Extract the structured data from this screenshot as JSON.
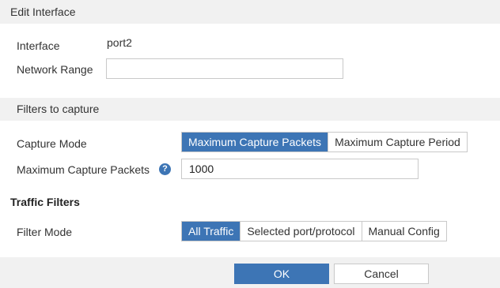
{
  "dialog": {
    "title": "Edit Interface"
  },
  "interface": {
    "label": "Interface",
    "value": "port2"
  },
  "network_range": {
    "label": "Network Range",
    "value": ""
  },
  "filters_section": {
    "title": "Filters to capture"
  },
  "capture_mode": {
    "label": "Capture Mode",
    "options": [
      "Maximum Capture Packets",
      "Maximum Capture Period"
    ],
    "selected": "Maximum Capture Packets"
  },
  "max_packets": {
    "label": "Maximum Capture Packets",
    "help_icon": "question-circle",
    "help_glyph": "?",
    "value": "1000"
  },
  "traffic_filters": {
    "title": "Traffic Filters"
  },
  "filter_mode": {
    "label": "Filter Mode",
    "options": [
      "All Traffic",
      "Selected port/protocol",
      "Manual Config"
    ],
    "selected": "All Traffic"
  },
  "footer": {
    "ok_label": "OK",
    "cancel_label": "Cancel"
  },
  "colors": {
    "accent": "#3d75b5",
    "header_bg": "#f1f1f1",
    "border": "#c9c9c9"
  }
}
